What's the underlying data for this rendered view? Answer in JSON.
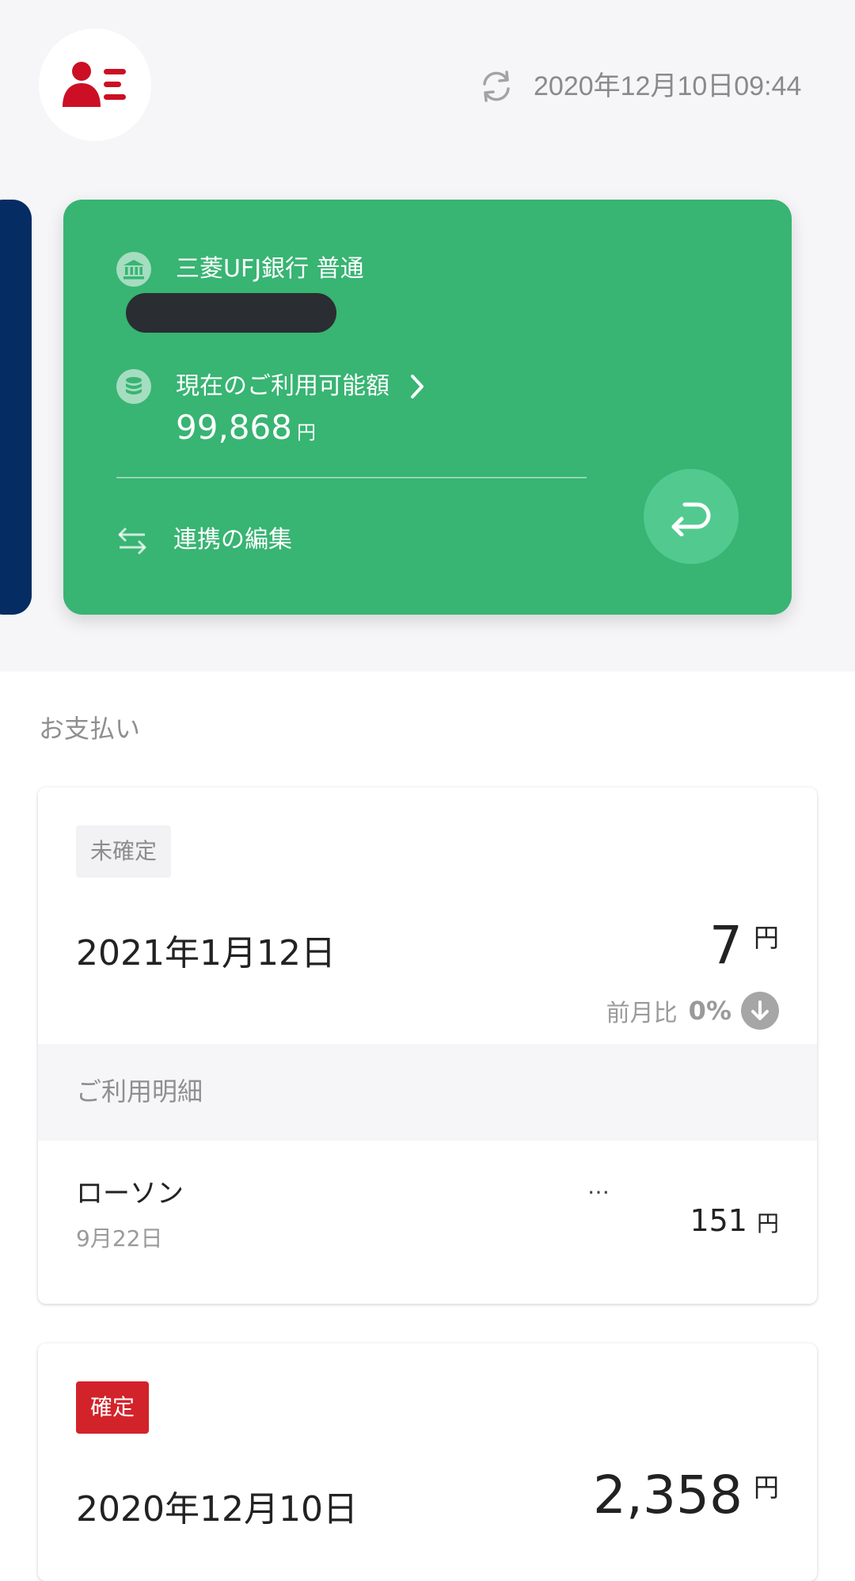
{
  "header": {
    "timestamp": "2020年12月10日09:44",
    "icons": {
      "profile": "profile-list-icon",
      "sync": "sync-icon"
    },
    "brand_color": "#cc0f24"
  },
  "bank_card": {
    "color": "#38b473",
    "bank_name": "三菱UFJ銀行 普通",
    "available_label": "現在のご利用可能額",
    "available_amount": "99,868",
    "currency_unit": "円",
    "edit_link_label": "連携の編集"
  },
  "payments": {
    "section_title": "お支払い",
    "cards": [
      {
        "status": "未確定",
        "date": "2021年1月12日",
        "amount": "7",
        "unit": "円",
        "compare_label": "前月比",
        "compare_value": "0%",
        "detail_header": "ご利用明細",
        "transactions": [
          {
            "merchant": "ローソン",
            "date": "9月22日",
            "more": "…",
            "amount": "151",
            "unit": "円"
          }
        ]
      },
      {
        "status": "確定",
        "status_color": "#d2232a",
        "date": "2020年12月10日",
        "amount": "2,358",
        "unit": "円"
      }
    ]
  }
}
